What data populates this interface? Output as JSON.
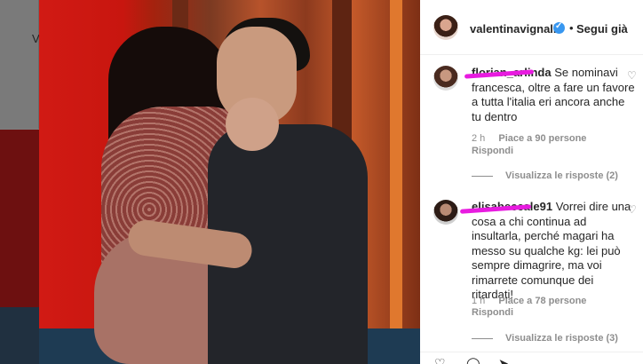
{
  "background": {
    "partial_letter": "V"
  },
  "post": {
    "username": "valentinavignali",
    "separator": "•",
    "follow_label": "Segui già"
  },
  "comments": [
    {
      "username": "florian_arlinda",
      "text": "Se nominavi francesca, oltre a fare un favore a tutta l'italia eri ancora anche tu dentro",
      "time": "2 h",
      "likes": "Piace a 90 persone",
      "reply_label": "Rispondi",
      "view_replies": "Visualizza le risposte (2)"
    },
    {
      "username": "elisabeccale91",
      "text": "Vorrei dire una cosa a chi continua ad insultarla, perché magari ha messo su qualche kg: lei può sempre dimagrire, ma voi rimarrete comunque dei ritardati!",
      "time": "1 h",
      "likes": "Piace a 78 persone",
      "reply_label": "Rispondi",
      "view_replies": "Visualizza le risposte (3)"
    }
  ],
  "icons": {
    "verified": "verified-badge-icon",
    "like": "heart-icon",
    "comment": "comment-icon",
    "share": "share-icon"
  },
  "colors": {
    "verified_blue": "#3897f0",
    "scribble_magenta": "#e81be0",
    "muted_text": "#8e8e8e",
    "primary_text": "#262626"
  }
}
